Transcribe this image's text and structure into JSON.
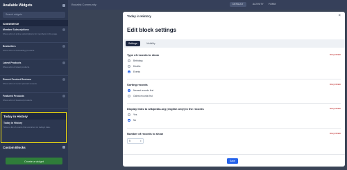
{
  "sidebar": {
    "title": "Available Widgets",
    "search_placeholder": "Search widgets",
    "section_commerce": "Commerce",
    "items": [
      {
        "title": "Member Subscriptions",
        "desc": "Show a list of active subscriptions for members in the page."
      },
      {
        "title": "Bestsellers",
        "desc": "Show a list of bestselling products."
      },
      {
        "title": "Latest Products",
        "desc": "Show a list of latest products."
      },
      {
        "title": "Recent Product Reviews",
        "desc": "Show a list of recent product reviews."
      },
      {
        "title": "Featured Products",
        "desc": "Show a list of featured products."
      }
    ],
    "highlight": {
      "section": "Today in History",
      "item_title": "Today in History",
      "item_desc": "Show a list of events that occurred on today's date."
    },
    "custom_blocks": "Custom Blocks",
    "create_button": "Create a widget"
  },
  "topbar": {
    "brand": "Brutalist Community",
    "tab1": "DEFAULT",
    "tab2": "ACTIVITY",
    "tab3": "FORM"
  },
  "modal": {
    "header_title": "Today in History",
    "close_label": "×",
    "title": "Edit block settings",
    "tabs": [
      "Settings",
      "Visibility"
    ],
    "required": "REQUIRED",
    "q1": {
      "label": "Type of records to show",
      "options": [
        "Birthdays",
        "Deaths",
        "Events"
      ],
      "selected": 2
    },
    "q2": {
      "label": "Sorting records",
      "options": [
        "Newest records first",
        "Oldest records first"
      ],
      "selected": 0
    },
    "q3": {
      "label": "Display links to wikipedia.org (english only) in the records",
      "options": [
        "Yes",
        "No"
      ],
      "selected": 1
    },
    "q4": {
      "label": "Number of records to show",
      "value": "5"
    },
    "save": "Save"
  },
  "colors": {
    "accent": "#2563eb",
    "highlight": "#ffe70b",
    "sidebar": "#2c3750"
  }
}
